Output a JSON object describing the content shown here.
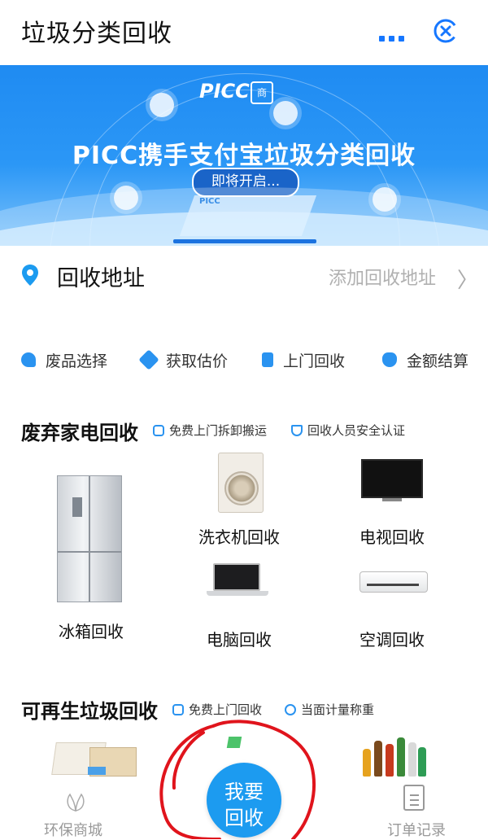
{
  "header": {
    "title": "垃圾分类回收"
  },
  "banner": {
    "logo_text": "PICC",
    "logo_sub": "商",
    "headline": "PICC携手支付宝垃圾分类回收",
    "pill": "即将开启...",
    "platform_label": "PICC"
  },
  "address": {
    "label": "回收地址",
    "action": "添加回收地址",
    "chevron": "〉"
  },
  "steps": [
    {
      "label": "废品选择",
      "icon": "hand-pointer-icon"
    },
    {
      "label": "获取估价",
      "icon": "tag-icon"
    },
    {
      "label": "上门回收",
      "icon": "book-icon"
    },
    {
      "label": "金额结算",
      "icon": "money-bag-icon"
    }
  ],
  "appliances": {
    "title": "废弃家电回收",
    "tags": [
      "免费上门拆卸搬运",
      "回收人员安全认证"
    ],
    "items": [
      "冰箱回收",
      "洗衣机回收",
      "电视回收",
      "电脑回收",
      "空调回收"
    ]
  },
  "recyclables": {
    "title": "可再生垃圾回收",
    "tags": [
      "免费上门回收",
      "当面计量称重"
    ]
  },
  "bottom": {
    "left_tab": "环保商城",
    "right_tab": "订单记录",
    "fab_line1": "我要",
    "fab_line2": "回收"
  },
  "colors": {
    "accent": "#1c9bf0",
    "brand_blue": "#1677ff",
    "annotation_red": "#e0141c"
  }
}
